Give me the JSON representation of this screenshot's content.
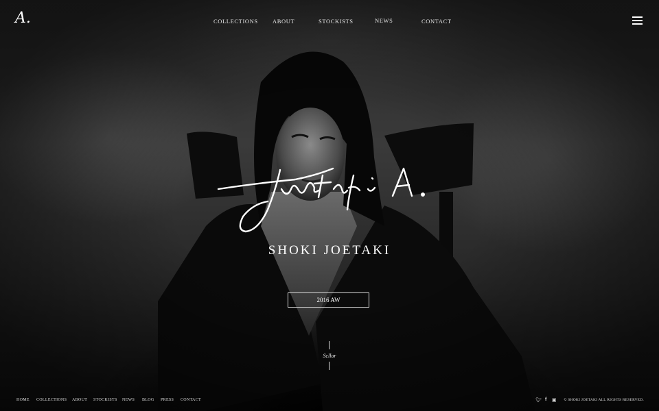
{
  "logo": "A.",
  "nav": {
    "items": [
      "COLLECTIONS",
      "ABOUT",
      "STOCKISTS",
      "NEWS",
      "CONTACT"
    ]
  },
  "menu_icon": "hamburger-icon",
  "hero": {
    "signature": "Joetaki A.",
    "brand": "SHOKI JOETAKI",
    "season_button": "2016 AW",
    "scroll_label": "Scllor"
  },
  "footer": {
    "nav": [
      "HOME",
      "COLLECTIONS",
      "ABOUT",
      "STOCKISTS",
      "NEWS",
      "BLOG",
      "PRESS",
      "CONTACT"
    ],
    "social": [
      "twitter-icon",
      "facebook-icon",
      "instagram-icon"
    ],
    "copyright": "© SHOKI JOETAKI ALL RIGHTS RESERVED."
  }
}
